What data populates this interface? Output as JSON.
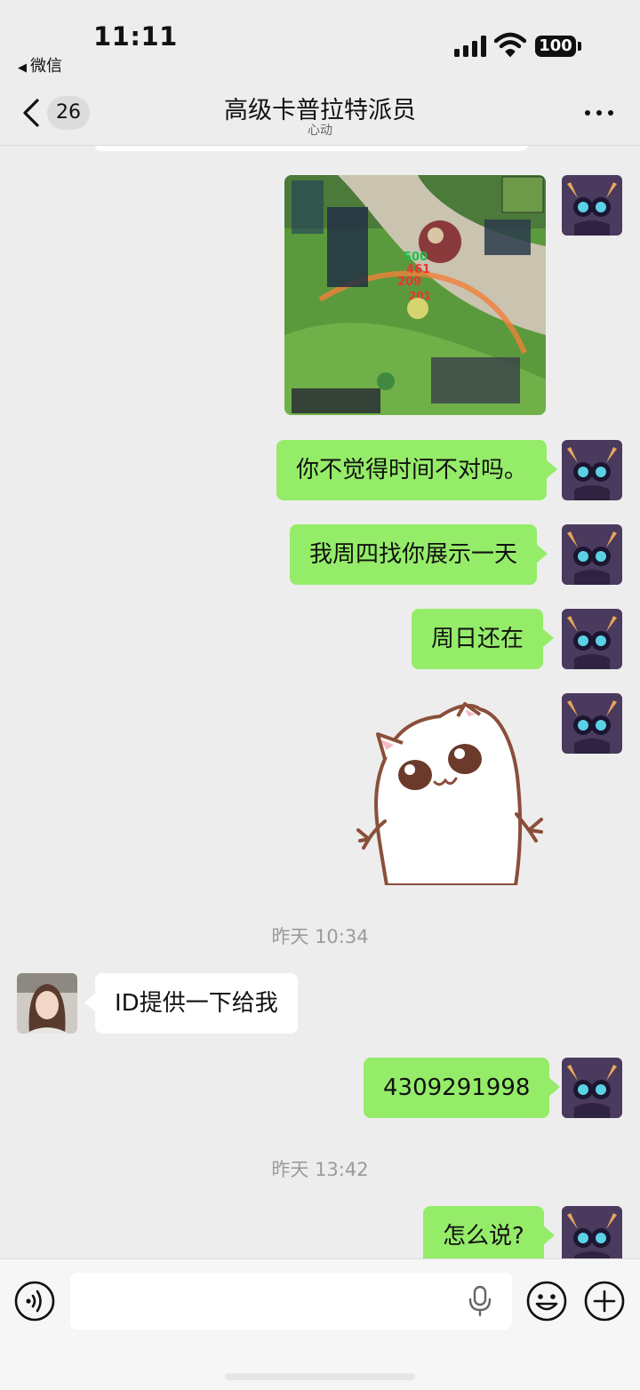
{
  "status_bar": {
    "time": "11:11",
    "back_app": "微信",
    "battery": "100"
  },
  "nav": {
    "unread_count": "26",
    "title": "高级卡普拉特派员",
    "subtitle": "心动"
  },
  "messages": [
    {
      "type": "image",
      "side": "me",
      "description": "game screenshot"
    },
    {
      "type": "text",
      "side": "me",
      "text": "你不觉得时间不对吗。"
    },
    {
      "type": "text",
      "side": "me",
      "text": "我周四找你展示一天"
    },
    {
      "type": "text",
      "side": "me",
      "text": "周日还在"
    },
    {
      "type": "sticker",
      "side": "me",
      "description": "white cat shrugging sticker"
    },
    {
      "type": "timestamp",
      "text": "昨天 10:34"
    },
    {
      "type": "text",
      "side": "other",
      "text": "ID提供一下给我"
    },
    {
      "type": "text",
      "side": "me",
      "text": "4309291998"
    },
    {
      "type": "timestamp",
      "text": "昨天 13:42"
    },
    {
      "type": "text",
      "side": "me",
      "text": "怎么说?"
    }
  ],
  "input_bar": {
    "value": "",
    "icons": [
      "voice-icon",
      "microphone-icon",
      "emoji-icon",
      "plus-icon"
    ]
  },
  "colors": {
    "background": "#ededed",
    "my_bubble": "#95ec69",
    "other_bubble": "#ffffff",
    "timestamp": "#9b9b9b"
  }
}
